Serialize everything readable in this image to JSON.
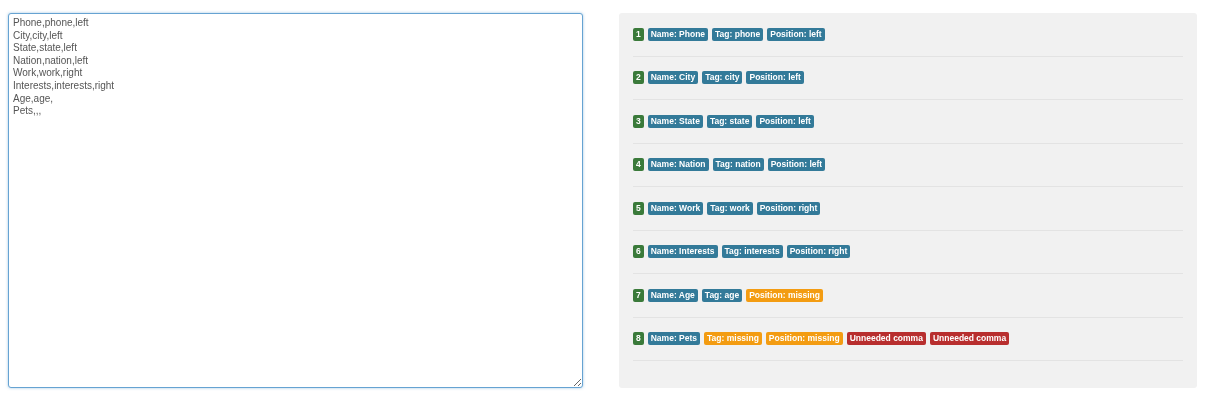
{
  "editor": {
    "lines": [
      "Phone,phone,left",
      "City,city,left",
      "State,state,left",
      "Nation,nation,left",
      "Work,work,right",
      "Interests,interests,right",
      "Age,age,",
      "Pets,,,"
    ],
    "focused": true
  },
  "results": [
    {
      "number": "1",
      "tags": [
        {
          "kind": "info",
          "text": "Name: Phone"
        },
        {
          "kind": "info",
          "text": "Tag: phone"
        },
        {
          "kind": "info",
          "text": "Position: left"
        }
      ]
    },
    {
      "number": "2",
      "tags": [
        {
          "kind": "info",
          "text": "Name: City"
        },
        {
          "kind": "info",
          "text": "Tag: city"
        },
        {
          "kind": "info",
          "text": "Position: left"
        }
      ]
    },
    {
      "number": "3",
      "tags": [
        {
          "kind": "info",
          "text": "Name: State"
        },
        {
          "kind": "info",
          "text": "Tag: state"
        },
        {
          "kind": "info",
          "text": "Position: left"
        }
      ]
    },
    {
      "number": "4",
      "tags": [
        {
          "kind": "info",
          "text": "Name: Nation"
        },
        {
          "kind": "info",
          "text": "Tag: nation"
        },
        {
          "kind": "info",
          "text": "Position: left"
        }
      ]
    },
    {
      "number": "5",
      "tags": [
        {
          "kind": "info",
          "text": "Name: Work"
        },
        {
          "kind": "info",
          "text": "Tag: work"
        },
        {
          "kind": "info",
          "text": "Position: right"
        }
      ]
    },
    {
      "number": "6",
      "tags": [
        {
          "kind": "info",
          "text": "Name: Interests"
        },
        {
          "kind": "info",
          "text": "Tag: interests"
        },
        {
          "kind": "info",
          "text": "Position: right"
        }
      ]
    },
    {
      "number": "7",
      "tags": [
        {
          "kind": "info",
          "text": "Name: Age"
        },
        {
          "kind": "info",
          "text": "Tag: age"
        },
        {
          "kind": "warning",
          "text": "Position: missing"
        }
      ]
    },
    {
      "number": "8",
      "tags": [
        {
          "kind": "info",
          "text": "Name: Pets"
        },
        {
          "kind": "warning",
          "text": "Tag: missing"
        },
        {
          "kind": "warning",
          "text": "Position: missing"
        },
        {
          "kind": "error",
          "text": "Unneeded comma"
        },
        {
          "kind": "error",
          "text": "Unneeded comma"
        }
      ]
    }
  ]
}
